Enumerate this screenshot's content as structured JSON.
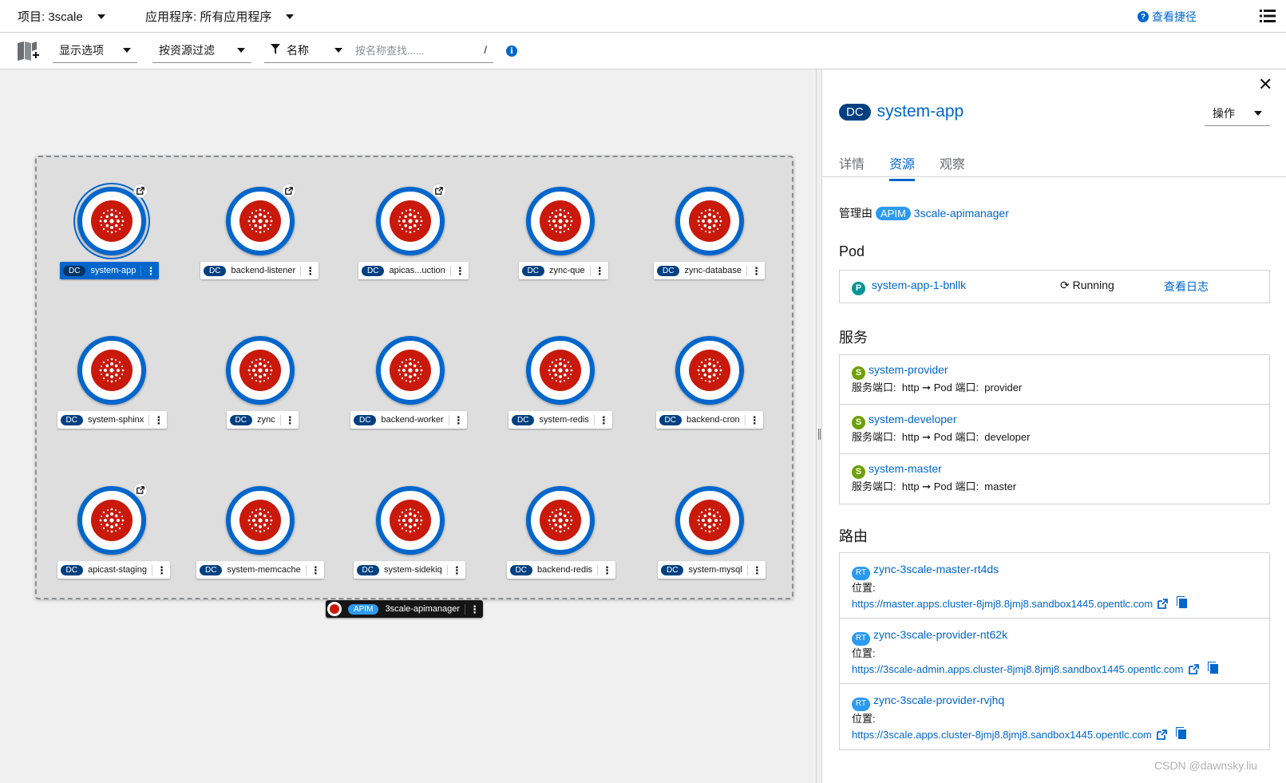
{
  "header": {
    "project_label": "项目: 3scale",
    "application_label": "应用程序: 所有应用程序",
    "shortcuts_label": "查看捷径"
  },
  "toolbar": {
    "display_options": "显示选项",
    "filter_by_resource": "按资源过滤",
    "name_filter": "名称",
    "search_placeholder": "按名称查找......",
    "search_shortcut": "/"
  },
  "topology": {
    "nodes": [
      {
        "badge": "DC",
        "name": "system-app"
      },
      {
        "badge": "DC",
        "name": "backend-listener"
      },
      {
        "badge": "DC",
        "name": "apicas...uction"
      },
      {
        "badge": "DC",
        "name": "zync-que"
      },
      {
        "badge": "DC",
        "name": "zync-database"
      },
      {
        "badge": "DC",
        "name": "system-sphinx"
      },
      {
        "badge": "DC",
        "name": "zync"
      },
      {
        "badge": "DC",
        "name": "backend-worker"
      },
      {
        "badge": "DC",
        "name": "system-redis"
      },
      {
        "badge": "DC",
        "name": "backend-cron"
      },
      {
        "badge": "DC",
        "name": "apicast-staging"
      },
      {
        "badge": "DC",
        "name": "system-memcache"
      },
      {
        "badge": "DC",
        "name": "system-sidekiq"
      },
      {
        "badge": "DC",
        "name": "backend-redis"
      },
      {
        "badge": "DC",
        "name": "system-mysql"
      }
    ],
    "operator": {
      "badge": "APIM",
      "name": "3scale-apimanager"
    }
  },
  "panel": {
    "badge": "DC",
    "title": "system-app",
    "actions_label": "操作",
    "tabs": [
      "详情",
      "资源",
      "观察"
    ],
    "managed_by_label": "管理由",
    "managed_by_badge": "APIM",
    "managed_by_name": "3scale-apimanager",
    "pod_section": "Pod",
    "pod": {
      "icon": "P",
      "name": "system-app-1-bnllk",
      "status": "Running",
      "logs_link": "查看日志"
    },
    "services_section": "服务",
    "services": [
      {
        "icon": "S",
        "name": "system-provider",
        "port_label": "服务端口:",
        "port": "http",
        "arrow": "➞",
        "pod_port_label": "Pod 端口:",
        "pod_port": "provider"
      },
      {
        "icon": "S",
        "name": "system-developer",
        "port_label": "服务端口:",
        "port": "http",
        "arrow": "➞",
        "pod_port_label": "Pod 端口:",
        "pod_port": "developer"
      },
      {
        "icon": "S",
        "name": "system-master",
        "port_label": "服务端口:",
        "port": "http",
        "arrow": "➞",
        "pod_port_label": "Pod 端口:",
        "pod_port": "master"
      }
    ],
    "routes_section": "路由",
    "routes": [
      {
        "icon": "RT",
        "name": "zync-3scale-master-rt4ds",
        "location_label": "位置:",
        "url": "https://master.apps.cluster-8jmj8.8jmj8.sandbox1445.opentlc.com"
      },
      {
        "icon": "RT",
        "name": "zync-3scale-provider-nt62k",
        "location_label": "位置:",
        "url": "https://3scale-admin.apps.cluster-8jmj8.8jmj8.sandbox1445.opentlc.com"
      },
      {
        "icon": "RT",
        "name": "zync-3scale-provider-rvjhq",
        "location_label": "位置:",
        "url": "https://3scale.apps.cluster-8jmj8.8jmj8.sandbox1445.opentlc.com"
      }
    ]
  },
  "watermark": "CSDN @dawnsky.liu",
  "colors": {
    "accent": "#0066cc",
    "node_core": "#c9190b",
    "badge_dark": "#004080",
    "apim_badge": "#2b9af3"
  }
}
